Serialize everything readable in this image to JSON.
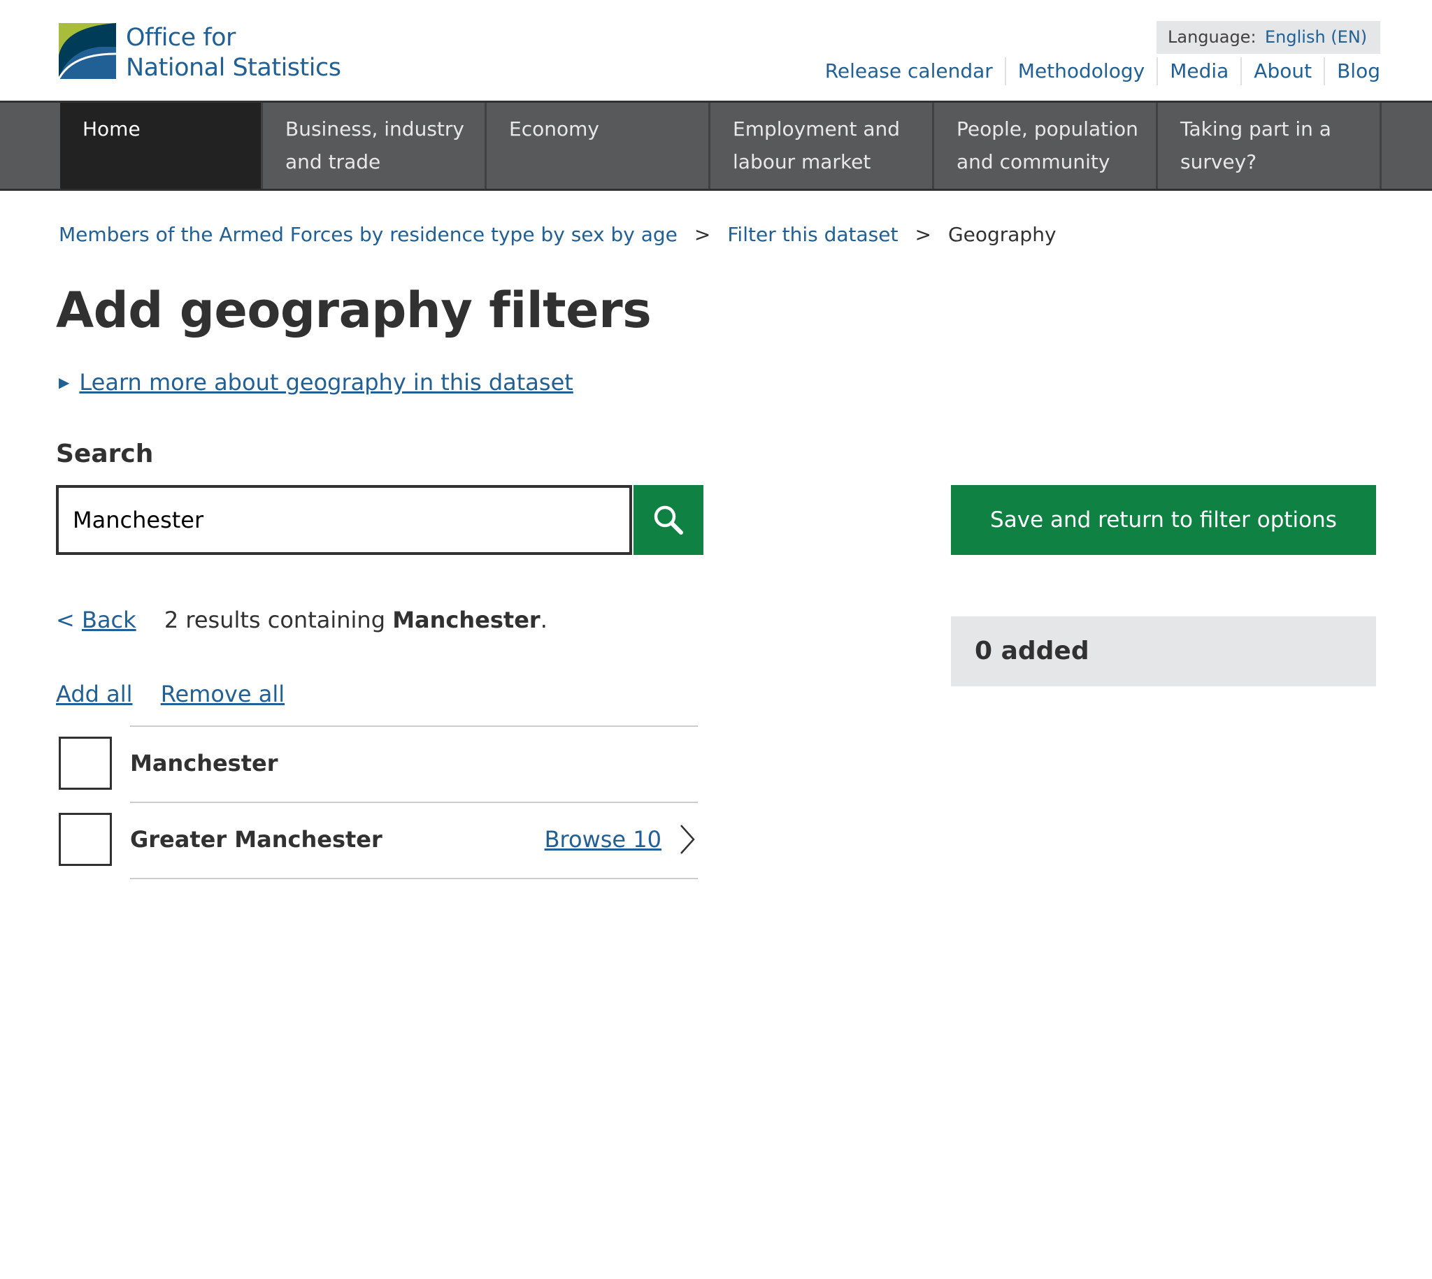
{
  "header": {
    "logo_line1": "Office for",
    "logo_line2": "National Statistics",
    "language_label": "Language:",
    "language_value": "English (EN)",
    "top_links": [
      "Release calendar",
      "Methodology",
      "Media",
      "About",
      "Blog"
    ]
  },
  "nav": {
    "items": [
      {
        "line1": "Home",
        "line2": ""
      },
      {
        "line1": "Business, industry",
        "line2": "and trade"
      },
      {
        "line1": "Economy",
        "line2": ""
      },
      {
        "line1": "Employment and",
        "line2": "labour market"
      },
      {
        "line1": "People, population",
        "line2": "and community"
      },
      {
        "line1": "Taking part in a",
        "line2": "survey?"
      }
    ]
  },
  "breadcrumb": {
    "items": [
      "Members of the Armed Forces by residence type by sex by age",
      "Filter this dataset"
    ],
    "separator": ">",
    "current": "Geography"
  },
  "page": {
    "title": "Add geography filters",
    "learn_more": "Learn more about geography in this dataset"
  },
  "search": {
    "label": "Search",
    "value": "Manchester",
    "button_icon": "search-icon"
  },
  "save_button_label": "Save and return to filter options",
  "added_summary": "0 added",
  "results": {
    "back_prefix": "<",
    "back_label": "Back",
    "summary_prefix": "2 results containing",
    "query": "Manchester",
    "summary_suffix": ".",
    "add_all": "Add all",
    "remove_all": "Remove all",
    "items": [
      {
        "label": "Manchester",
        "checked": false,
        "browse": ""
      },
      {
        "label": "Greater Manchester",
        "checked": false,
        "browse": "Browse 10"
      }
    ]
  },
  "colors": {
    "link": "#206095",
    "nav_bg": "#58595b",
    "nav_active": "#222222",
    "button_green": "#0f8243",
    "panel_grey": "#e5e6e7",
    "text": "#323132"
  }
}
